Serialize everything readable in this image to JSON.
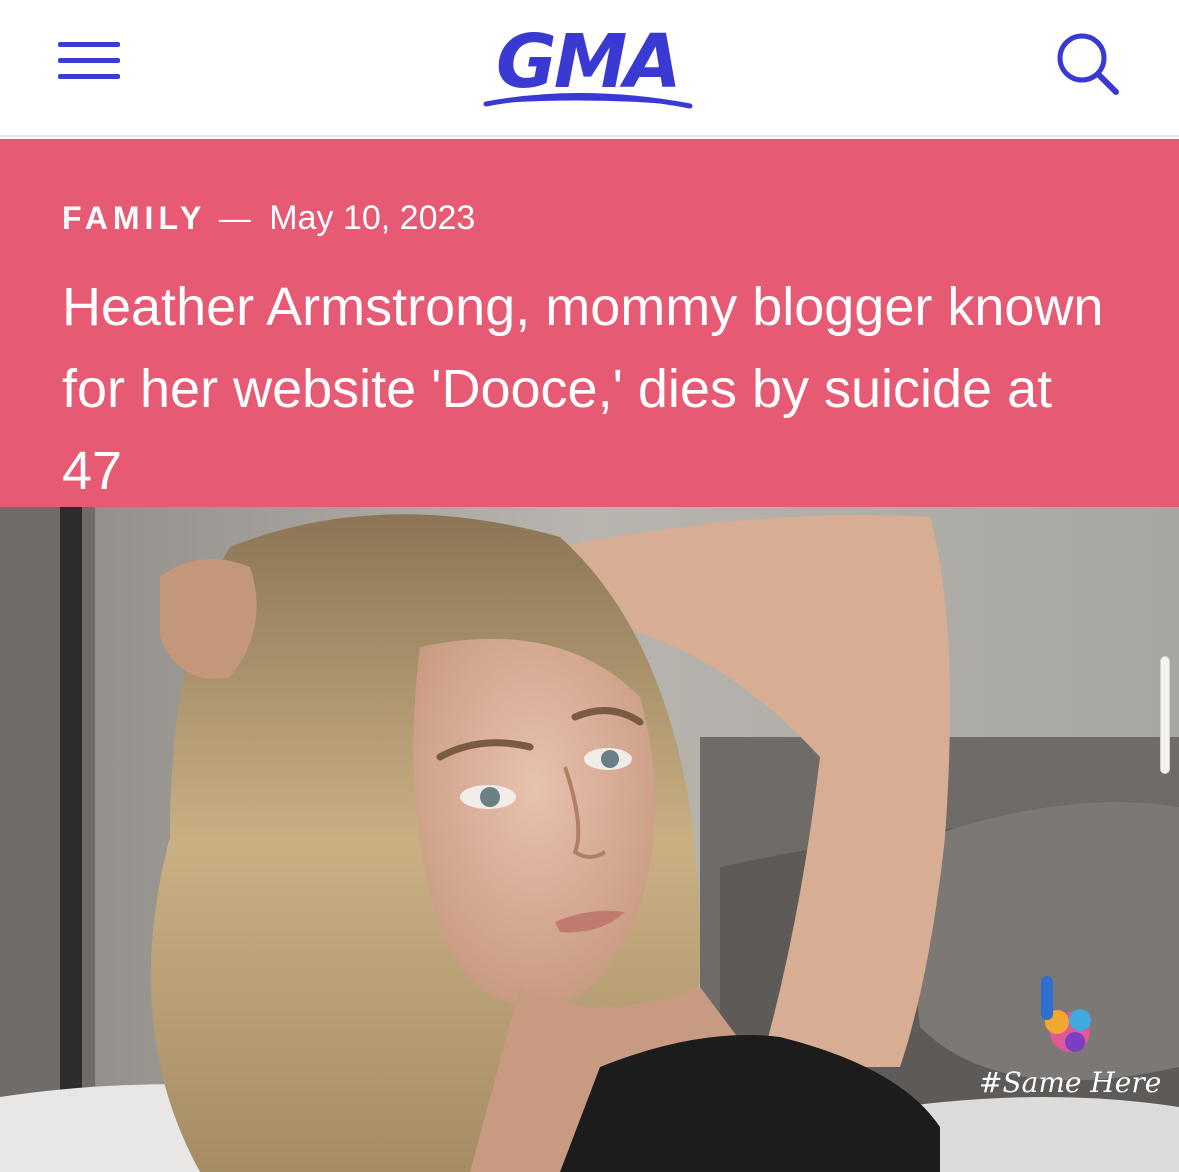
{
  "header": {
    "menu_icon": "hamburger-menu-icon",
    "logo_text": "GMA",
    "search_icon": "search-icon",
    "accent_color": "#3a3ad3"
  },
  "article": {
    "category": "FAMILY",
    "separator": "—",
    "date": "May 10, 2023",
    "title": "Heather Armstrong, mommy blogger known for her website 'Dooce,' dies by suicide at 47",
    "band_color": "#e65a74"
  },
  "photo": {
    "watermark_text": "#Same Here"
  }
}
